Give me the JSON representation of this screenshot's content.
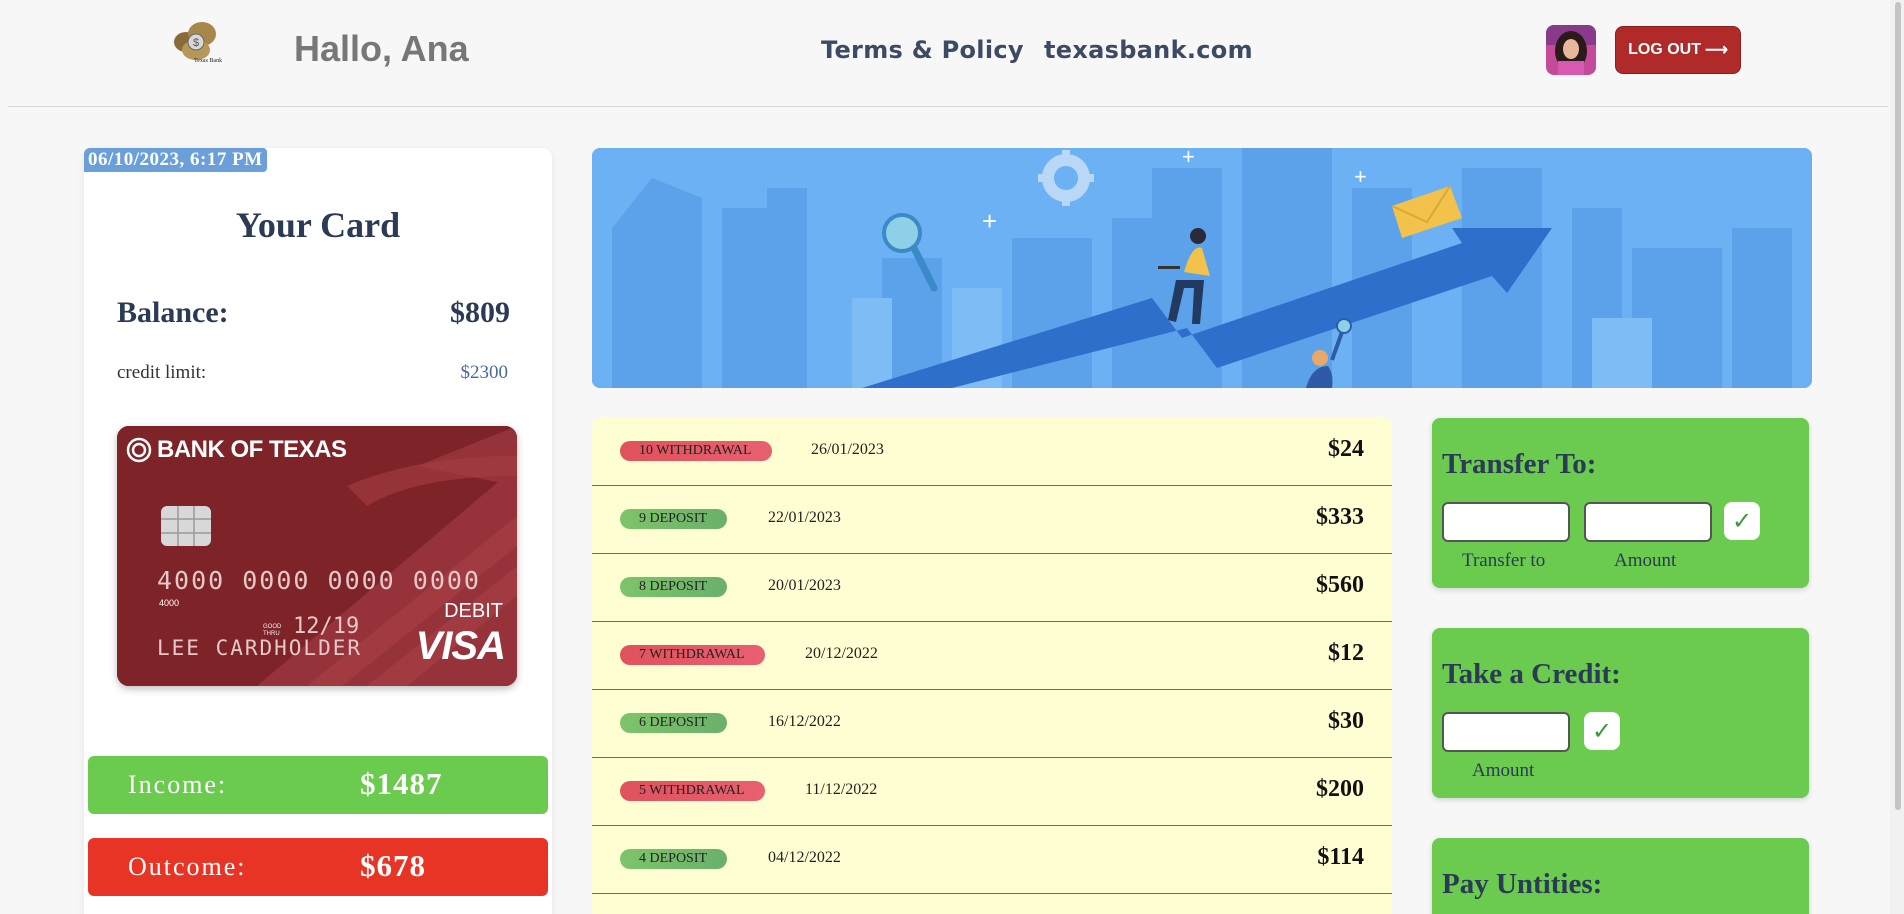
{
  "header": {
    "logo_text": "Texas Bank",
    "greeting": "Hallo, Ana",
    "nav": [
      "Terms & Policy",
      "texasbank.com"
    ],
    "logout_label": "LOG OUT",
    "logout_icon": "arrow-right-icon"
  },
  "card_panel": {
    "datetime": "06/10/2023, 6:17 PM",
    "title": "Your Card",
    "balance_label": "Balance:",
    "balance_value": "$809",
    "credit_label": "credit limit:",
    "credit_value": "$2300",
    "bank_card": {
      "bank_name": "BANK OF TEXAS",
      "number": "4000 0000 0000 0000",
      "small_number": "4000",
      "valid_label": "GOOD THRU",
      "expiry": "12/19",
      "holder": "LEE CARDHOLDER",
      "type": "DEBIT",
      "network": "VISA"
    },
    "income_label": "Income:",
    "income_value": "$1487",
    "outcome_label": "Outcome:",
    "outcome_value": "$678"
  },
  "transactions": [
    {
      "badge": "10 WITHDRAWAL",
      "kind": "withdrawal",
      "date": "26/01/2023",
      "amount": "$24"
    },
    {
      "badge": "9 DEPOSIT",
      "kind": "deposit",
      "date": "22/01/2023",
      "amount": "$333"
    },
    {
      "badge": "8 DEPOSIT",
      "kind": "deposit",
      "date": "20/01/2023",
      "amount": "$560"
    },
    {
      "badge": "7 WITHDRAWAL",
      "kind": "withdrawal",
      "date": "20/12/2022",
      "amount": "$12"
    },
    {
      "badge": "6 DEPOSIT",
      "kind": "deposit",
      "date": "16/12/2022",
      "amount": "$30"
    },
    {
      "badge": "5 WITHDRAWAL",
      "kind": "withdrawal",
      "date": "11/12/2022",
      "amount": "$200"
    },
    {
      "badge": "4 DEPOSIT",
      "kind": "deposit",
      "date": "04/12/2022",
      "amount": "$114"
    }
  ],
  "transfer": {
    "title": "Transfer To:",
    "to_label": "Transfer to",
    "amount_label": "Amount",
    "to_value": "",
    "amount_value": "",
    "confirm": "✓"
  },
  "credit": {
    "title": "Take a Credit:",
    "amount_label": "Amount",
    "amount_value": "",
    "confirm": "✓"
  },
  "utilities": {
    "title": "Pay Untities:"
  },
  "colors": {
    "income": "#6acb4e",
    "outcome": "#e83425",
    "withdrawal": "#e0525c",
    "deposit": "#7dc46b",
    "banner": "#6cb1f3",
    "logout": "#b02a2a"
  }
}
